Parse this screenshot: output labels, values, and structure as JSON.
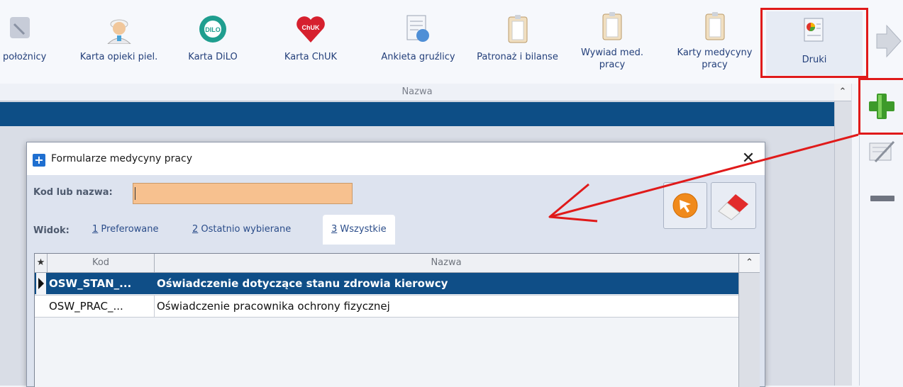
{
  "toolbar": {
    "items": [
      {
        "label": "położnicy",
        "icon": "partial-hand-icon"
      },
      {
        "label": "Karta opieki piel.",
        "icon": "nurse-icon"
      },
      {
        "label": "Karta DiLO",
        "icon": "dilo-icon",
        "icon_text": "DILO"
      },
      {
        "label": "Karta ChUK",
        "icon": "heart-icon",
        "icon_text": "ChUK"
      },
      {
        "label": "Ankieta gruźlicy",
        "icon": "survey-icon"
      },
      {
        "label": "Patronaż i bilanse",
        "icon": "clipboard-icon"
      },
      {
        "label": "Wywiad med. pracy",
        "icon": "clipboard-icon"
      },
      {
        "label": "Karty medycyny pracy",
        "icon": "clipboard-icon"
      },
      {
        "label": "Druki",
        "icon": "print-forms-icon"
      }
    ]
  },
  "background_grid": {
    "column_header": "Nazwa"
  },
  "dialog": {
    "title": "Formularze medycyny pracy",
    "search": {
      "label": "Kod lub nazwa:",
      "value": "",
      "placeholder": ""
    },
    "widok": {
      "label": "Widok:",
      "tabs": [
        {
          "key": "1",
          "label": "Preferowane"
        },
        {
          "key": "2",
          "label": "Ostatnio wybierane"
        },
        {
          "key": "3",
          "label": "Wszystkie",
          "selected": true
        }
      ]
    },
    "table": {
      "columns": [
        "★",
        "Kod",
        "Nazwa"
      ],
      "rows": [
        {
          "kod": "OSW_STAN_...",
          "nazwa": "Oświadczenie dotyczące stanu zdrowia kierowcy",
          "selected": true
        },
        {
          "kod": "OSW_PRAC_...",
          "nazwa": "Oświadczenie pracownika ochrony fizycznej",
          "selected": false
        }
      ]
    }
  },
  "colors": {
    "selection": "#0f4e87",
    "annotation": "#e01a1a",
    "input_bg": "#f7c18f"
  }
}
